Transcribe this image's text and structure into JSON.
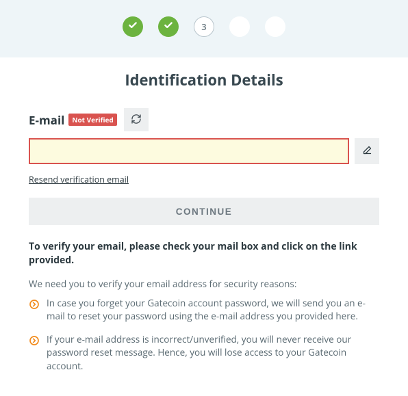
{
  "stepper": {
    "current_step": "3"
  },
  "page": {
    "title": "Identification Details"
  },
  "email": {
    "label": "E-mail",
    "badge": "Not Verified",
    "value": "",
    "placeholder": "",
    "resend_link": "Resend verification email"
  },
  "buttons": {
    "continue": "CONTINUE"
  },
  "info": {
    "strong": "To verify your email, please check your mail box and click on the link provided.",
    "sub": "We need you to verify your email address for security reasons:",
    "items": [
      "In case you forget your Gatecoin account password, we will send you an e-mail to reset your password using the e-mail address you provided here.",
      "If your e-mail address is incorrect/unverified, you will never receive our password reset message. Hence, you will lose access to your Gatecoin account."
    ]
  },
  "colors": {
    "accent_green": "#6cb33f",
    "danger": "#d9534f",
    "bullet_orange": "#f28c1e"
  }
}
